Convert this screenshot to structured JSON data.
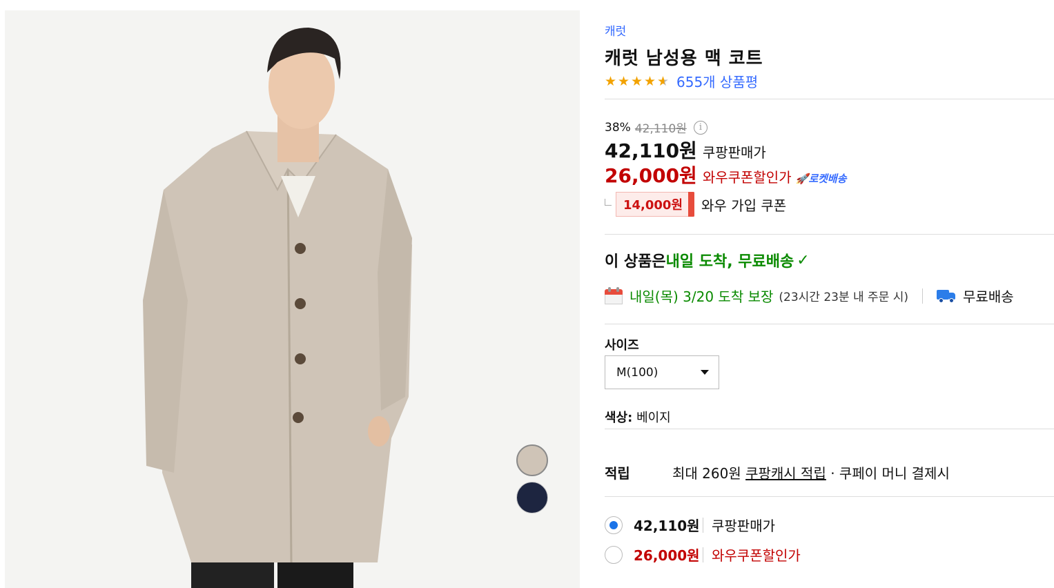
{
  "product": {
    "brand": "캐럿",
    "title": "캐럿 남성용 맥 코트",
    "rating": 4.5,
    "review_count": "655개 상품평"
  },
  "pricing": {
    "discount_rate": "38%",
    "original_price": "42,110원",
    "sale_price": "42,110원",
    "sale_label": "쿠팡판매가",
    "wow_price": "26,000원",
    "wow_label": "와우쿠폰할인가",
    "rocket_label": "로켓배송",
    "coupon_amount": "14,000원",
    "coupon_text": "와우 가입 쿠폰"
  },
  "delivery": {
    "headline_prefix": "이 상품은 ",
    "headline_highlight": "내일 도착, 무료배송",
    "arrival_date": "내일(목) 3/20 도착 보장",
    "arrival_note": "(23시간 23분 내 주문 시)",
    "free_shipping": "무료배송"
  },
  "options": {
    "size_label": "사이즈",
    "size_value": "M(100)",
    "color_label": "색상:",
    "color_value": "베이지",
    "swatches": [
      "#cfc4b7",
      "#1d2540"
    ]
  },
  "points": {
    "label": "적립",
    "text_before": "최대 260원 ",
    "link": "쿠팡캐시 적립",
    "text_after": " · 쿠페이 머니 결제시"
  },
  "price_options": [
    {
      "price": "42,110원",
      "name": "쿠팡판매가",
      "checked": true
    },
    {
      "price": "26,000원",
      "name": "와우쿠폰할인가",
      "checked": false
    }
  ],
  "colors": {
    "link_blue": "#346aff",
    "star_orange": "#f2a200",
    "price_red": "#c20000",
    "delivery_green": "#0a8a00"
  }
}
